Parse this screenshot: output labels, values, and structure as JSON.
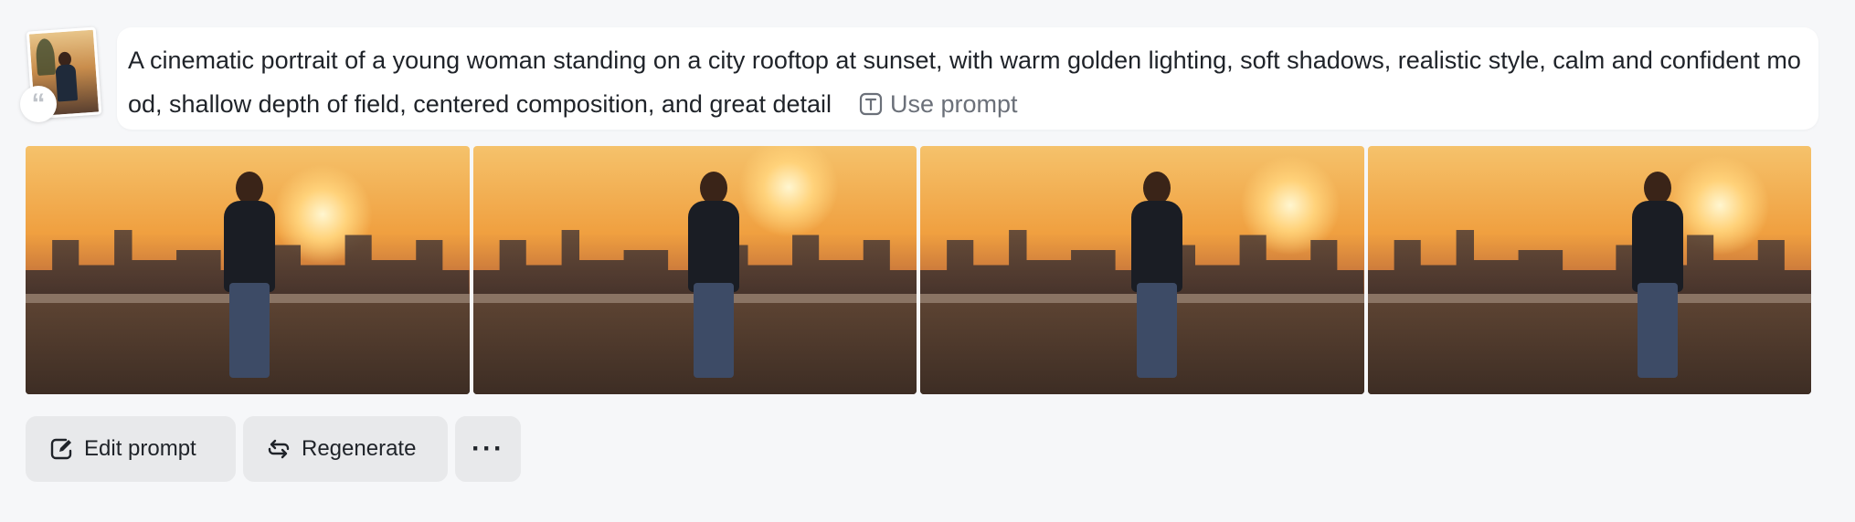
{
  "prompt": {
    "text": "A cinematic portrait of a young woman standing on a city rooftop at sunset, with warm golden lighting, soft shadows, realistic style, calm and confident mood, shallow depth of field, centered composition, and great detail",
    "use_prompt_label": "Use prompt",
    "quote_glyph": "“"
  },
  "images": [
    {
      "name": "generated-image-1"
    },
    {
      "name": "generated-image-2"
    },
    {
      "name": "generated-image-3"
    },
    {
      "name": "generated-image-4"
    }
  ],
  "actions": {
    "edit_label": "Edit prompt",
    "regenerate_label": "Regenerate",
    "more_label": "···"
  },
  "colors": {
    "background": "#f6f7f9",
    "card": "#ffffff",
    "button": "#e8e9eb",
    "text": "#1f2329",
    "muted": "#6b7079"
  }
}
